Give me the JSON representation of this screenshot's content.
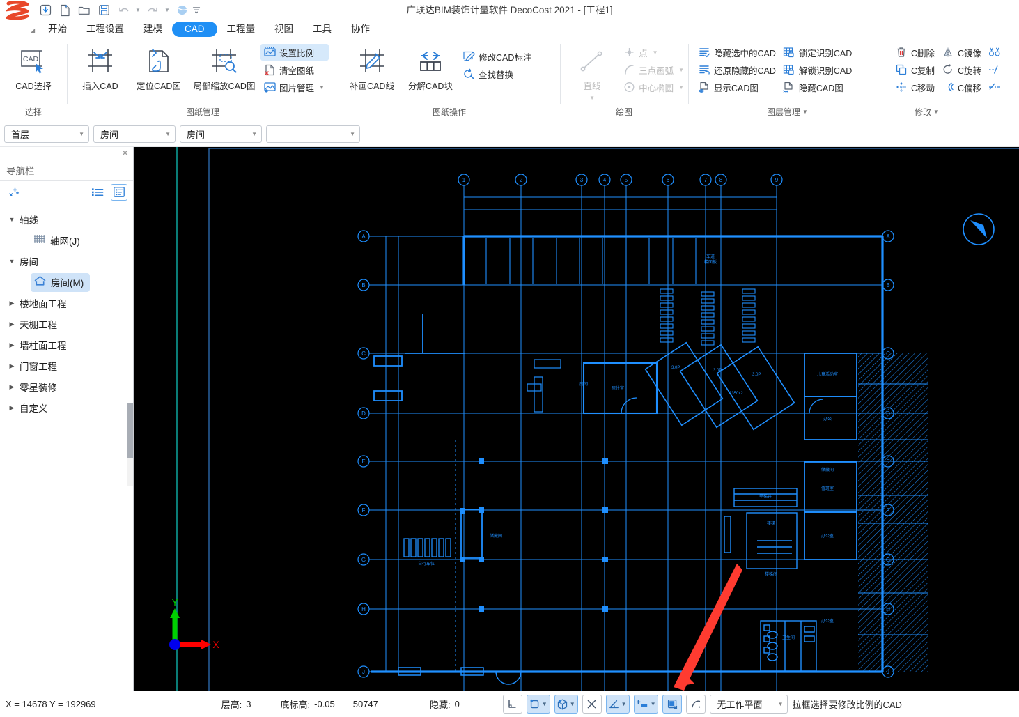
{
  "window": {
    "title": "广联达BIM装饰计量软件 DecoCost 2021 - [工程1]"
  },
  "quick_access": {
    "items": [
      {
        "icon": "download-icon",
        "name": "download"
      },
      {
        "icon": "new-file-icon",
        "name": "new-project"
      },
      {
        "icon": "open-folder-icon",
        "name": "open-project"
      },
      {
        "icon": "save-icon",
        "name": "save-project"
      },
      {
        "icon": "undo-icon",
        "name": "undo"
      },
      {
        "icon": "redo-icon",
        "name": "redo"
      },
      {
        "icon": "cloud-icon",
        "name": "cloud"
      },
      {
        "icon": "more-icon",
        "name": "customize-toolbar"
      }
    ]
  },
  "tabs": [
    {
      "label": "开始",
      "active": false
    },
    {
      "label": "工程设置",
      "active": false
    },
    {
      "label": "建模",
      "active": false
    },
    {
      "label": "CAD",
      "active": true
    },
    {
      "label": "工程量",
      "active": false
    },
    {
      "label": "视图",
      "active": false
    },
    {
      "label": "工具",
      "active": false
    },
    {
      "label": "协作",
      "active": false
    }
  ],
  "ribbon": {
    "groups": [
      {
        "label": "选择",
        "caret": false,
        "big_buttons": [
          {
            "label": "CAD选择",
            "icon": "cad-select-icon"
          }
        ],
        "small_buttons": []
      },
      {
        "label": "图纸管理",
        "caret": false,
        "big_buttons": [
          {
            "label": "插入CAD",
            "icon": "insert-cad-icon"
          },
          {
            "label": "定位CAD图",
            "icon": "locate-cad-icon"
          },
          {
            "label": "局部缩放CAD图",
            "icon": "zoom-cad-icon"
          }
        ],
        "small_buttons": [
          {
            "label": "设置比例",
            "icon": "set-scale-icon",
            "selected": true,
            "caret": false,
            "disabled": false
          },
          {
            "label": "清空图纸",
            "icon": "clear-drawing-icon",
            "selected": false,
            "caret": false,
            "disabled": false
          },
          {
            "label": "图片管理",
            "icon": "image-manage-icon",
            "selected": false,
            "caret": true,
            "disabled": false
          }
        ]
      },
      {
        "label": "图纸操作",
        "caret": false,
        "big_buttons": [
          {
            "label": "补画CAD线",
            "icon": "draw-cad-line-icon"
          },
          {
            "label": "分解CAD块",
            "icon": "explode-cad-block-icon"
          }
        ],
        "small_buttons": [
          {
            "label": "修改CAD标注",
            "icon": "edit-cad-dimension-icon",
            "selected": false,
            "caret": false,
            "disabled": false
          },
          {
            "label": "查找替换",
            "icon": "find-replace-icon",
            "selected": false,
            "caret": false,
            "disabled": false
          }
        ]
      },
      {
        "label": "绘图",
        "caret": false,
        "big_buttons": [
          {
            "label": "直线",
            "icon": "line-icon",
            "disabled": true,
            "caret": true
          }
        ],
        "small_buttons": [
          {
            "label": "点",
            "icon": "point-icon",
            "selected": false,
            "caret": true,
            "disabled": true
          },
          {
            "label": "三点画弧",
            "icon": "three-point-arc-icon",
            "selected": false,
            "caret": true,
            "disabled": true
          },
          {
            "label": "中心椭圆",
            "icon": "center-ellipse-icon",
            "selected": false,
            "caret": true,
            "disabled": true
          }
        ]
      },
      {
        "label": "图层管理",
        "caret": true,
        "big_buttons": [],
        "columns": [
          [
            {
              "label": "隐藏选中的CAD",
              "icon": "hide-selected-cad-icon"
            },
            {
              "label": "还原隐藏的CAD",
              "icon": "restore-hidden-cad-icon"
            },
            {
              "label": "显示CAD图",
              "icon": "show-cad-drawing-icon"
            }
          ],
          [
            {
              "label": "锁定识别CAD",
              "icon": "lock-recognize-cad-icon"
            },
            {
              "label": "解锁识别CAD",
              "icon": "unlock-recognize-cad-icon"
            },
            {
              "label": "隐藏CAD图",
              "icon": "hide-cad-drawing-icon"
            }
          ]
        ]
      },
      {
        "label": "修改",
        "caret": true,
        "big_buttons": [],
        "columns": [
          [
            {
              "label": "C删除",
              "icon": "trash-icon"
            },
            {
              "label": "C复制",
              "icon": "copy-icon"
            },
            {
              "label": "C移动",
              "icon": "move-icon"
            }
          ],
          [
            {
              "label": "C镜像",
              "icon": "mirror-icon"
            },
            {
              "label": "C旋转",
              "icon": "rotate-icon"
            },
            {
              "label": "C偏移",
              "icon": "offset-icon"
            }
          ],
          [
            {
              "label": "",
              "icon": "align-icon"
            },
            {
              "label": "",
              "icon": "trim-icon"
            },
            {
              "label": "",
              "icon": "extend-icon"
            }
          ]
        ]
      }
    ]
  },
  "selectors": [
    {
      "value": "首层",
      "name": "floor-selector"
    },
    {
      "value": "房间",
      "name": "category-selector"
    },
    {
      "value": "房间",
      "name": "subcategory-selector"
    },
    {
      "value": "",
      "name": "component-selector"
    }
  ],
  "sidebar": {
    "title": "导航栏",
    "tools": {
      "add": "add-item-icon",
      "list": "list-view-icon",
      "detail": "detail-view-icon"
    },
    "tree": [
      {
        "type": "node",
        "label": "轴线",
        "expanded": true,
        "selected": false
      },
      {
        "type": "leaf",
        "label": "轴网(J)",
        "icon": "grid-icon",
        "selected": false
      },
      {
        "type": "node",
        "label": "房间",
        "expanded": true,
        "selected": false
      },
      {
        "type": "leaf",
        "label": "房间(M)",
        "icon": "room-icon",
        "selected": true
      },
      {
        "type": "node",
        "label": "楼地面工程",
        "expanded": false,
        "selected": false
      },
      {
        "type": "node",
        "label": "天棚工程",
        "expanded": false,
        "selected": false
      },
      {
        "type": "node",
        "label": "墙柱面工程",
        "expanded": false,
        "selected": false
      },
      {
        "type": "node",
        "label": "门窗工程",
        "expanded": false,
        "selected": false
      },
      {
        "type": "node",
        "label": "零星装修",
        "expanded": false,
        "selected": false
      },
      {
        "type": "node",
        "label": "自定义",
        "expanded": false,
        "selected": false
      }
    ]
  },
  "canvas": {
    "background": "#000000",
    "line_color": "#1f8fff",
    "axis": {
      "x_label": "X",
      "y_label": "Y",
      "x_color": "#ff0000",
      "y_color": "#00d000",
      "origin_color": "#0000ff"
    },
    "grid_labels_top": [
      "1",
      "2",
      "3",
      "4",
      "5",
      "6",
      "7",
      "8",
      "9"
    ],
    "grid_labels_side": [
      "A",
      "B",
      "C",
      "D",
      "E",
      "F",
      "G",
      "H",
      "J"
    ],
    "annotation_arrow_color": "#ff3b30"
  },
  "statusbar": {
    "coordinates": "X = 14678 Y = 192969",
    "floor_height_label": "层高:",
    "floor_height_value": "3",
    "base_elevation_label": "底标高:",
    "base_elevation_value": "-0.05",
    "extra_value": "50747",
    "hidden_label": "隐藏:",
    "hidden_value": "0",
    "buttons": [
      {
        "name": "ortho-toggle",
        "icon": "ortho-icon",
        "active": false,
        "caret": false
      },
      {
        "name": "snap-object-toggle",
        "icon": "object-snap-icon",
        "active": true,
        "caret": true
      },
      {
        "name": "three-d-snap-toggle",
        "icon": "cube-snap-icon",
        "active": true,
        "caret": true
      },
      {
        "name": "intersection-snap-toggle",
        "icon": "intersection-icon",
        "active": false,
        "caret": false
      },
      {
        "name": "angle-snap-toggle",
        "icon": "angle-icon",
        "active": true,
        "caret": true
      },
      {
        "name": "dimension-toggle",
        "icon": "dimension-icon",
        "active": true,
        "caret": true
      },
      {
        "name": "display-toggle",
        "icon": "display-icon",
        "active": true,
        "caret": false
      },
      {
        "name": "curve-tool",
        "icon": "curve-icon",
        "active": false,
        "caret": false
      }
    ],
    "workplane": "无工作平面",
    "hint": "拉框选择要修改比例的CAD"
  }
}
